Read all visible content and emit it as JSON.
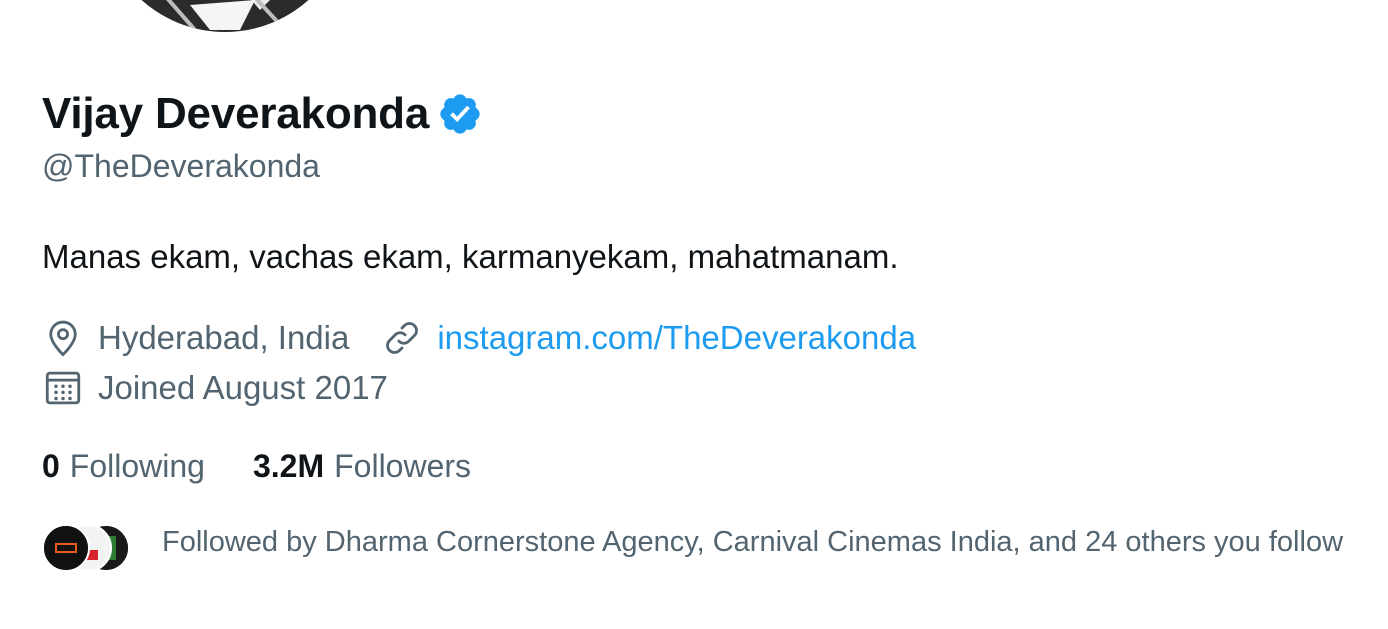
{
  "profile": {
    "name": "Vijay Deverakonda",
    "verified_icon": "verified-badge-icon",
    "handle": "@TheDeverakonda",
    "bio": "Manas ekam, vachas ekam, karmanyekam, mahatmanam.",
    "location": "Hyderabad, India",
    "location_icon": "location-pin-icon",
    "website": "instagram.com/TheDeverakonda",
    "website_icon": "link-icon",
    "joined": "Joined August 2017",
    "joined_icon": "calendar-icon"
  },
  "stats": {
    "following_count": "0",
    "following_label": "Following",
    "followers_count": "3.2M",
    "followers_label": "Followers"
  },
  "followed_by": {
    "text": "Followed by Dharma Cornerstone Agency, Carnival Cinemas India, and 24 others you follow",
    "avatars": [
      "DCA",
      "Carnival Cinemas",
      "Follower"
    ]
  },
  "colors": {
    "text_primary": "#0f1419",
    "text_secondary": "#536471",
    "accent": "#1d9bf0"
  }
}
